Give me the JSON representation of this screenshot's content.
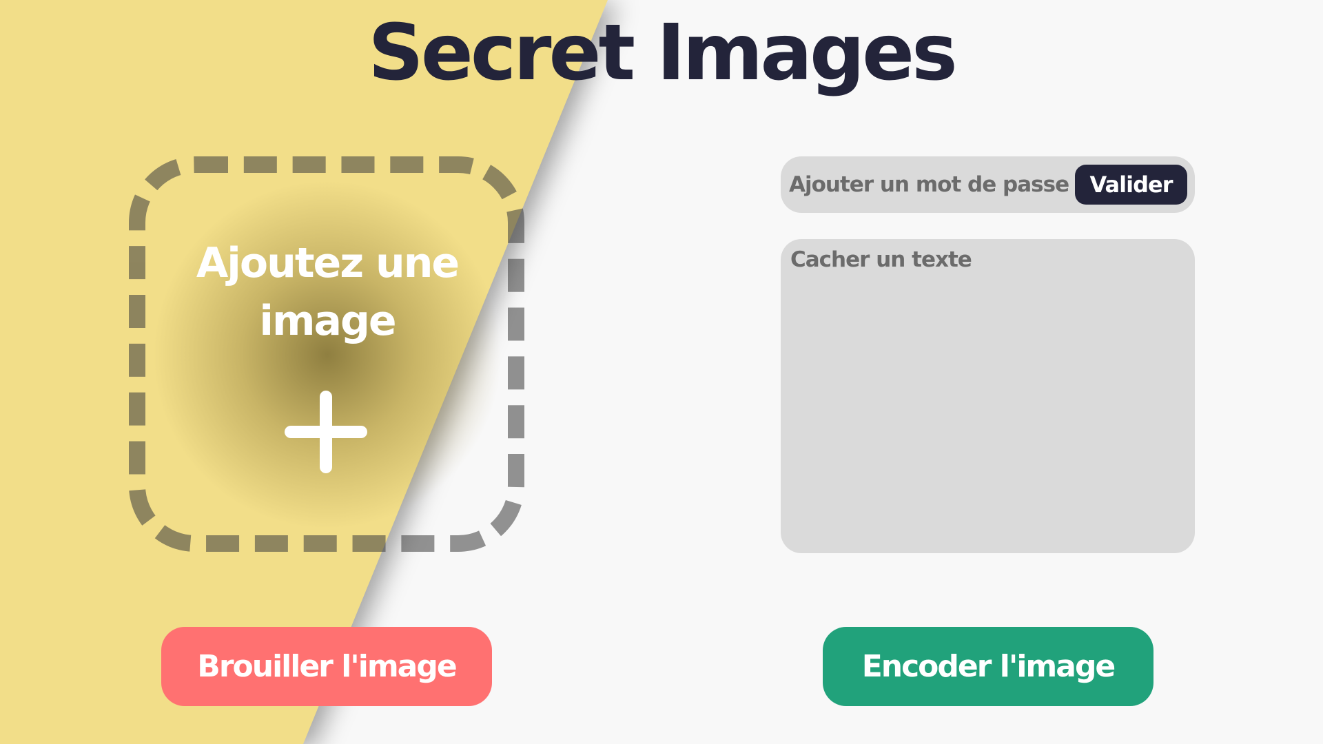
{
  "app": {
    "title": "Secret Images"
  },
  "dropzone": {
    "label": "Ajoutez une image",
    "icon": "plus-icon"
  },
  "password": {
    "placeholder": "Ajouter un mot de passe",
    "value": "",
    "submit_label": "Valider"
  },
  "secret_text": {
    "placeholder": "Cacher un texte",
    "value": ""
  },
  "actions": {
    "scramble_label": "Brouiller l'image",
    "encode_label": "Encoder l'image"
  },
  "colors": {
    "background": "#f8f8f8",
    "panel_yellow": "#f2de89",
    "title": "#23243a",
    "scramble": "#ff7171",
    "encode": "#21a27b",
    "field": "#dadada"
  }
}
